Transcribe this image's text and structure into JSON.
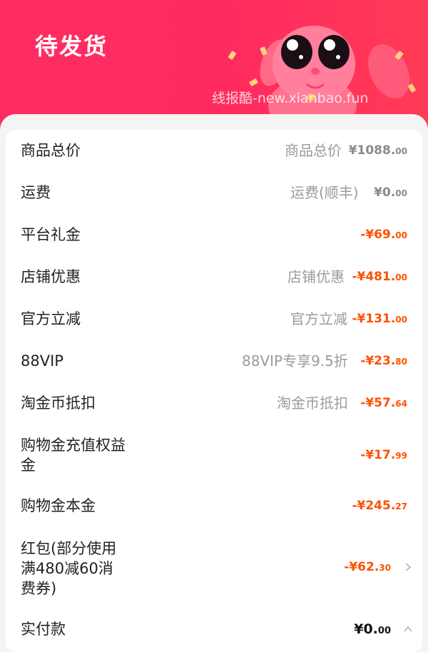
{
  "header": {
    "title": "待发货",
    "watermark": "线报酷-new.xianbao.fun",
    "mascot_icon": "pink-bunny-mascot"
  },
  "colors": {
    "brand": "#ff2b5f",
    "discount": "#ff5000",
    "muted": "#9b9b9b"
  },
  "rows": [
    {
      "label": "商品总价",
      "desc": "商品总价",
      "amount_main": "¥1088.",
      "amount_cents": "00"
    },
    {
      "label": "运费",
      "desc": "运费(顺丰)",
      "amount_main": "¥0.",
      "amount_cents": "00"
    },
    {
      "label": "平台礼金",
      "desc": "",
      "amount_main": "-¥69.",
      "amount_cents": "00"
    },
    {
      "label": "店铺优惠",
      "desc": "店铺优惠",
      "amount_main": "-¥481.",
      "amount_cents": "00"
    },
    {
      "label": "官方立减",
      "desc": "官方立减",
      "amount_main": "-¥131.",
      "amount_cents": "00"
    },
    {
      "label": "88VIP",
      "desc": "88VIP专享9.5折",
      "amount_main": "-¥23.",
      "amount_cents": "80"
    },
    {
      "label": "淘金币抵扣",
      "desc": "淘金币抵扣",
      "amount_main": "-¥57.",
      "amount_cents": "64"
    },
    {
      "label": "购物金充值权益金",
      "desc": "",
      "amount_main": "-¥17.",
      "amount_cents": "99"
    },
    {
      "label": "购物金本金",
      "desc": "",
      "amount_main": "-¥245.",
      "amount_cents": "27"
    },
    {
      "label": "红包(部分使用满480减60消费券)",
      "desc": "",
      "amount_main": "-¥62.",
      "amount_cents": "30"
    },
    {
      "label": "实付款",
      "desc": "",
      "amount_main": "¥0.",
      "amount_cents": "00"
    }
  ]
}
